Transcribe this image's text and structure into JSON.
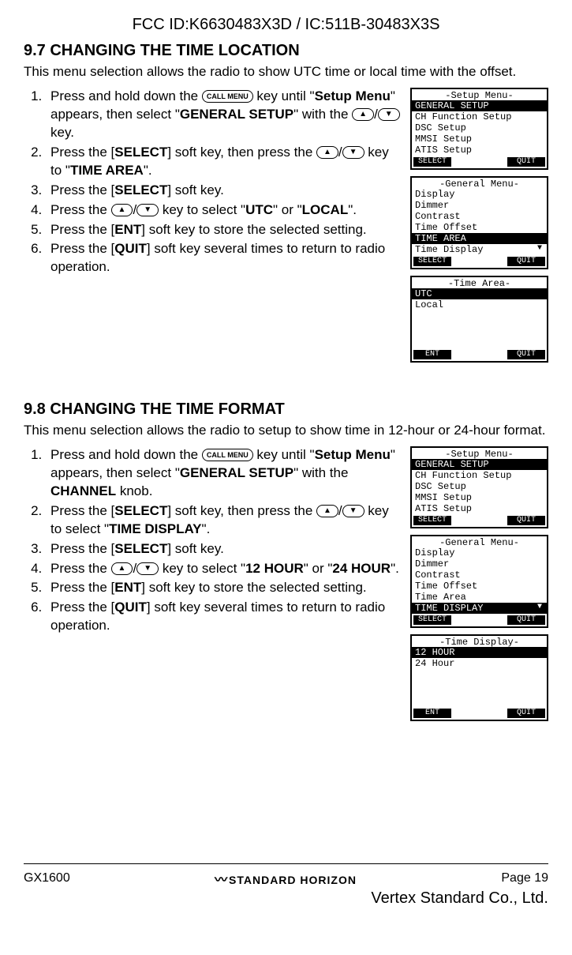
{
  "header": {
    "fcc": "FCC ID:K6630483X3D / IC:511B-30483X3S"
  },
  "section97": {
    "title": "9.7   CHANGING THE TIME LOCATION",
    "intro": "This menu selection allows the radio to show UTC time or local time with the offset.",
    "steps": {
      "s1a": "Press and hold down the ",
      "s1key": "CALL MENU",
      "s1b": " key until \"",
      "s1menu": "Setup Menu",
      "s1c": "\" appears, then select \"",
      "s1gen": "GENERAL SETUP",
      "s1d": "\" with the ",
      "s1e": " key.",
      "s2a": "Press the [",
      "s2sel": "SELECT",
      "s2b": "] soft key, then press the ",
      "s2c": " key to \"",
      "s2area": "TIME AREA",
      "s2d": "\".",
      "s3a": "Press the [",
      "s3sel": "SELECT",
      "s3b": "] soft key.",
      "s4a": "Press the ",
      "s4b": " key to select \"",
      "s4utc": "UTC",
      "s4c": "\" or \"",
      "s4local": "LOCAL",
      "s4d": "\".",
      "s5a": "Press the [",
      "s5ent": "ENT",
      "s5b": "] soft key to store the selected setting.",
      "s6a": "Press the [",
      "s6quit": "QUIT",
      "s6b": "] soft key several times to return to radio operation."
    },
    "lcd1": {
      "title": "-Setup Menu-",
      "r1": "GENERAL SETUP",
      "r2": "CH Function Setup",
      "r3": "DSC Setup",
      "r4": "MMSI Setup",
      "r5": "ATIS Setup",
      "sk1": "SELECT",
      "sk2": "QUIT"
    },
    "lcd2": {
      "title": "-General Menu-",
      "r1": "Display",
      "r2": "Dimmer",
      "r3": "Contrast",
      "r4": "Time Offset",
      "r5": "TIME AREA",
      "r6": "Time Display",
      "sk1": "SELECT",
      "sk2": "QUIT"
    },
    "lcd3": {
      "title": "-Time Area-",
      "r1": "UTC",
      "r2": "Local",
      "sk1": "ENT",
      "sk2": "QUIT"
    }
  },
  "section98": {
    "title": "9.8   CHANGING THE TIME FORMAT",
    "intro": "This menu selection allows the radio to setup to show time in 12-hour or 24-hour format.",
    "steps": {
      "s1a": "Press and hold down the ",
      "s1key": "CALL MENU",
      "s1b": " key until \"",
      "s1menu": "Setup Menu",
      "s1c": "\" appears, then select \"",
      "s1gen": "GENERAL SETUP",
      "s1d": "\" with the ",
      "s1ch": "CHANNEL",
      "s1e": " knob.",
      "s2a": "Press the [",
      "s2sel": "SELECT",
      "s2b": "] soft key, then press the ",
      "s2c": " key to select \"",
      "s2disp": "TIME DISPLAY",
      "s2d": "\".",
      "s3a": "Press the [",
      "s3sel": "SELECT",
      "s3b": "] soft key.",
      "s4a": "Press the ",
      "s4b": " key to select \"",
      "s4h12": "12 HOUR",
      "s4c": "\" or \"",
      "s4h24": "24 HOUR",
      "s4d": "\".",
      "s5a": "Press the [",
      "s5ent": "ENT",
      "s5b": "] soft key to store the selected setting.",
      "s6a": "Press the [",
      "s6quit": "QUIT",
      "s6b": "] soft key several times to return to radio operation."
    },
    "lcd1": {
      "title": "-Setup Menu-",
      "r1": "GENERAL SETUP",
      "r2": "CH Function Setup",
      "r3": "DSC Setup",
      "r4": "MMSI Setup",
      "r5": "ATIS Setup",
      "sk1": "SELECT",
      "sk2": "QUIT"
    },
    "lcd2": {
      "title": "-General Menu-",
      "r1": "Display",
      "r2": "Dimmer",
      "r3": "Contrast",
      "r4": "Time Offset",
      "r5": "Time Area",
      "r6": "TIME DISPLAY",
      "sk1": "SELECT",
      "sk2": "QUIT"
    },
    "lcd3": {
      "title": "-Time Display-",
      "r1": "12 HOUR",
      "r2": "24 Hour",
      "sk1": "ENT",
      "sk2": "QUIT"
    }
  },
  "footer": {
    "model": "GX1600",
    "brand": "STANDARD HORIZON",
    "page": "Page 19",
    "company": "Vertex Standard Co., Ltd."
  }
}
